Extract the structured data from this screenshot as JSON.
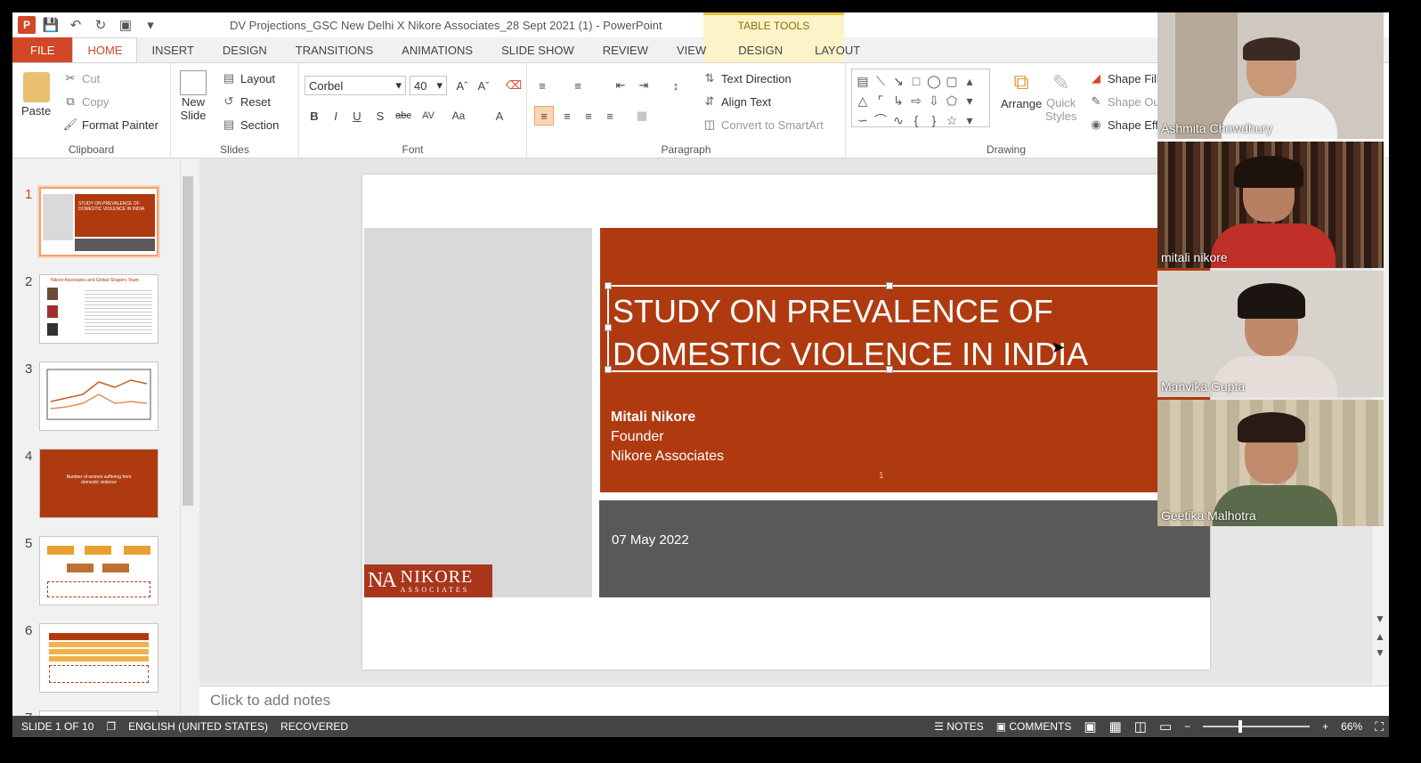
{
  "window": {
    "title": "DV Projections_GSC New Delhi X Nikore Associates_28 Sept 2021 (1) - PowerPoint",
    "contextual_group": "TABLE TOOLS"
  },
  "tabs": [
    "FILE",
    "HOME",
    "INSERT",
    "DESIGN",
    "TRANSITIONS",
    "ANIMATIONS",
    "SLIDE SHOW",
    "REVIEW",
    "VIEW",
    "DESIGN",
    "LAYOUT"
  ],
  "ribbon": {
    "clipboard": {
      "label": "Clipboard",
      "paste": "Paste",
      "cut": "Cut",
      "copy": "Copy",
      "format_painter": "Format Painter"
    },
    "slides": {
      "label": "Slides",
      "new_slide": "New",
      "new_slide2": "Slide",
      "layout": "Layout",
      "reset": "Reset",
      "section": "Section"
    },
    "font": {
      "label": "Font",
      "font_name": "Corbel",
      "font_size": "40"
    },
    "paragraph": {
      "label": "Paragraph",
      "text_direction": "Text Direction",
      "align_text": "Align Text",
      "convert_smartart": "Convert to SmartArt"
    },
    "drawing": {
      "label": "Drawing",
      "arrange": "Arrange",
      "quick_styles": "Quick",
      "quick_styles2": "Styles",
      "shape_fill": "Shape Fill",
      "shape_outline": "Shape Ou",
      "shape_effects": "Shape Effe"
    }
  },
  "thumbnails": [
    {
      "num": "1",
      "text": "STUDY ON PREVALENCE OF DOMESTIC VIOLENCE IN INDIA"
    },
    {
      "num": "2",
      "text": "Nikore Associates and Global Shapers Team"
    },
    {
      "num": "3",
      "text": ""
    },
    {
      "num": "4",
      "text": "Number of women suffering from domestic violence"
    },
    {
      "num": "5",
      "text": ""
    },
    {
      "num": "6",
      "text": ""
    },
    {
      "num": "7",
      "text": ""
    }
  ],
  "slide": {
    "title": "STUDY ON PREVALENCE OF DOMESTIC VIOLENCE IN INDIA",
    "author_name": "Mitali Nikore",
    "author_role": "Founder",
    "author_org": "Nikore Associates",
    "page_number": "1",
    "date": "07 May 2022",
    "logo_initials": "NA",
    "logo_name": "NIKORE",
    "logo_sub": "ASSOCIATES"
  },
  "notes_placeholder": "Click to add notes",
  "status": {
    "slide_info": "SLIDE 1 OF 10",
    "language": "ENGLISH (UNITED STATES)",
    "recovered": "RECOVERED",
    "notes": "NOTES",
    "comments": "COMMENTS",
    "zoom": "66%"
  },
  "participants": [
    "Ashmita Chowdhury",
    "mitali nikore",
    "Manvika Gupta",
    "Geetika Malhotra"
  ]
}
